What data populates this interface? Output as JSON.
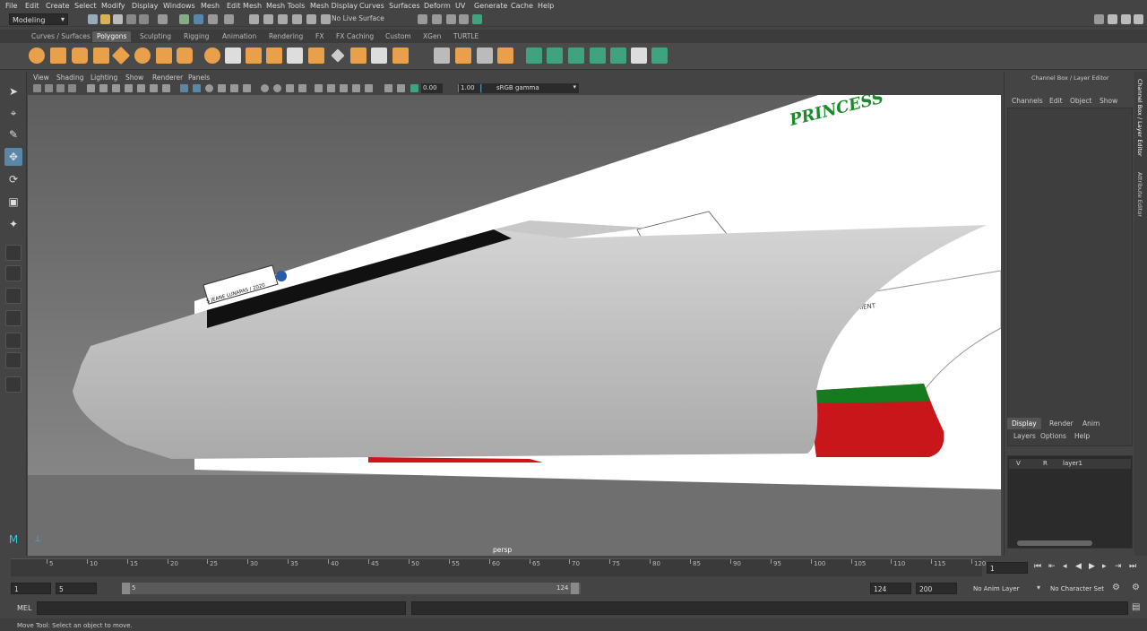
{
  "menubar": [
    "File",
    "Edit",
    "Create",
    "Select",
    "Modify",
    "Display",
    "Windows",
    "Mesh",
    "Edit Mesh",
    "Mesh Tools",
    "Mesh Display",
    "Curves",
    "Surfaces",
    "Deform",
    "UV",
    "Generate",
    "Cache",
    "Help"
  ],
  "status": {
    "mode": "Modeling",
    "live_surface": "No Live Surface"
  },
  "shelf_tabs": [
    "Curves / Surfaces",
    "Polygons",
    "Sculpting",
    "Rigging",
    "Animation",
    "Rendering",
    "FX",
    "FX Caching",
    "Custom",
    "XGen",
    "TURTLE"
  ],
  "shelf_active": "Polygons",
  "viewport": {
    "menu": [
      "View",
      "Shading",
      "Lighting",
      "Show",
      "Renderer",
      "Panels"
    ],
    "field1": "0.00",
    "field2": "1.00",
    "color_space": "sRGB gamma",
    "camera": "persp",
    "image_text": {
      "princess": "PRINCESS",
      "hull_name": "S JEANE LUNAPAS / 2020",
      "orient": "ORIENT"
    }
  },
  "channel_box": {
    "title": "Channel Box / Layer Editor",
    "menu": [
      "Channels",
      "Edit",
      "Object",
      "Show"
    ],
    "layer_tabs": [
      "Display",
      "Render",
      "Anim"
    ],
    "layer_menu": [
      "Layers",
      "Options",
      "Help"
    ],
    "layer": {
      "v": "V",
      "r": "R",
      "name": "layer1"
    },
    "side_tabs": [
      "Channel Box / Layer Editor",
      "Attribute Editor"
    ]
  },
  "timeline": {
    "ticks": [
      "5",
      "10",
      "15",
      "20",
      "25",
      "30",
      "35",
      "40",
      "45",
      "50",
      "55",
      "60",
      "65",
      "70",
      "75",
      "80",
      "85",
      "90",
      "95",
      "100",
      "105",
      "110",
      "115",
      "120"
    ],
    "current_frame": "1"
  },
  "range": {
    "start": "1",
    "anim_start": "5",
    "range_start": "5",
    "range_end": "124",
    "anim_end": "124",
    "end": "200",
    "anim_layer": "No Anim Layer",
    "character_set": "No Character Set"
  },
  "cmdline": {
    "label": "MEL"
  },
  "helpline": {
    "text": "Move Tool: Select an object to move."
  },
  "colors": {
    "accent": "#5a86a8",
    "shelf_orange": "#e8a14a",
    "shelf_green": "#3fa37f",
    "hull_red": "#c8161b",
    "hull_green": "#167a1e"
  }
}
